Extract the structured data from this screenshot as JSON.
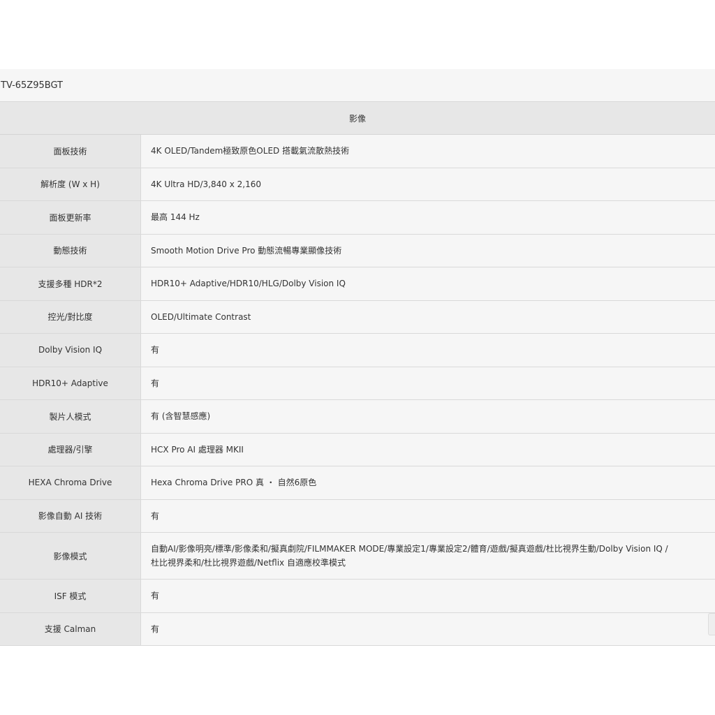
{
  "model": "TV-65Z95BGT",
  "section_title": "影像",
  "specs": [
    {
      "label": "面板技術",
      "value": "4K OLED/Tandem極致原色OLED 搭載氣流散熱技術"
    },
    {
      "label": "解析度 (W x H)",
      "value": "4K Ultra HD/3,840 x 2,160"
    },
    {
      "label": "面板更新率",
      "value": "最高 144 Hz"
    },
    {
      "label": "動態技術",
      "value": "Smooth Motion Drive Pro 動態流暢專業顯像技術"
    },
    {
      "label": "支援多種 HDR*2",
      "value": "HDR10+ Adaptive/HDR10/HLG/Dolby Vision IQ"
    },
    {
      "label": "控光/對比度",
      "value": "OLED/Ultimate Contrast"
    },
    {
      "label": "Dolby Vision IQ",
      "value": "有"
    },
    {
      "label": "HDR10+ Adaptive",
      "value": "有"
    },
    {
      "label": "製片人模式",
      "value": "有 (含智慧感應)"
    },
    {
      "label": "處理器/引擎",
      "value": "HCX Pro AI 處理器 MKII"
    },
    {
      "label": "HEXA Chroma Drive",
      "value": "Hexa Chroma Drive PRO 真 ・ 自然6原色"
    },
    {
      "label": "影像自動 AI 技術",
      "value": "有"
    },
    {
      "label": "影像模式",
      "value": "自動AI/影像明亮/標準/影像柔和/擬真劇院/FILMMAKER MODE/專業設定1/專業設定2/體育/遊戲/擬真遊戲/杜比視界生動/Dolby Vision IQ /\n杜比視界柔和/杜比視界遊戲/Netflix 自適應校準模式"
    },
    {
      "label": "ISF 模式",
      "value": "有"
    },
    {
      "label": "支援 Calman",
      "value": "有"
    }
  ]
}
